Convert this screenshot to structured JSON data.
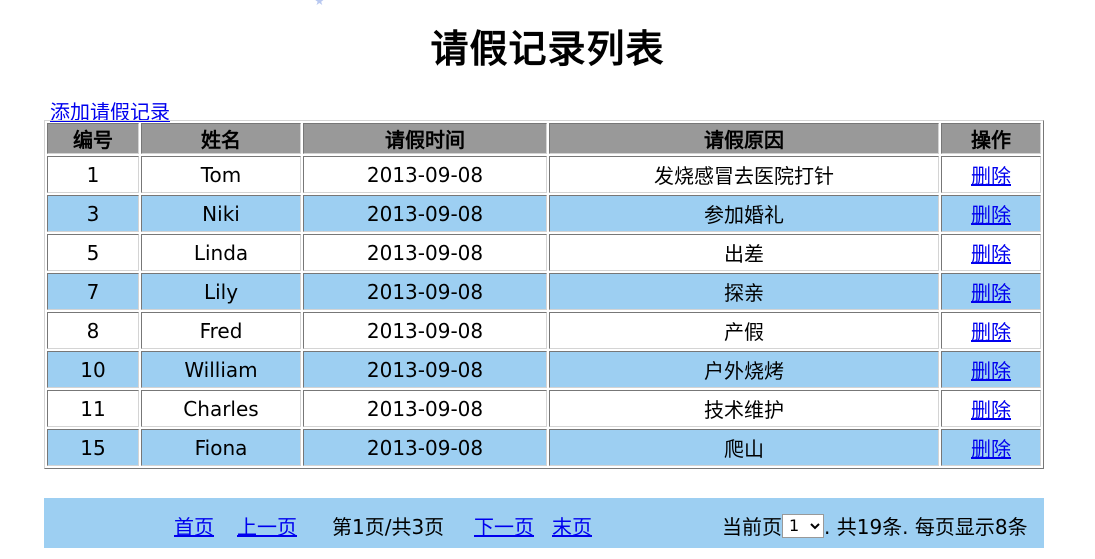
{
  "page": {
    "title": "请假记录列表",
    "add_link": "添加请假记录"
  },
  "table": {
    "headers": [
      "编号",
      "姓名",
      "请假时间",
      "请假原因",
      "操作"
    ],
    "rows": [
      {
        "id": "1",
        "name": "Tom",
        "date": "2013-09-08",
        "reason": "发烧感冒去医院打针",
        "action": "删除"
      },
      {
        "id": "3",
        "name": "Niki",
        "date": "2013-09-08",
        "reason": "参加婚礼",
        "action": "删除"
      },
      {
        "id": "5",
        "name": "Linda",
        "date": "2013-09-08",
        "reason": "出差",
        "action": "删除"
      },
      {
        "id": "7",
        "name": "Lily",
        "date": "2013-09-08",
        "reason": "探亲",
        "action": "删除"
      },
      {
        "id": "8",
        "name": "Fred",
        "date": "2013-09-08",
        "reason": "产假",
        "action": "删除"
      },
      {
        "id": "10",
        "name": "William",
        "date": "2013-09-08",
        "reason": "户外烧烤",
        "action": "删除"
      },
      {
        "id": "11",
        "name": "Charles",
        "date": "2013-09-08",
        "reason": "技术维护",
        "action": "删除"
      },
      {
        "id": "15",
        "name": "Fiona",
        "date": "2013-09-08",
        "reason": "爬山",
        "action": "删除"
      }
    ]
  },
  "pager": {
    "first": "首页",
    "prev": "上一页",
    "info": "第1页/共3页",
    "next": "下一页",
    "last": "末页",
    "current_label": "当前页",
    "current_value": "1",
    "summary": ". 共19条. 每页显示8条"
  },
  "colors": {
    "header_bg": "#999999",
    "row_alt_bg": "#9dcff2",
    "link": "#0000ee"
  }
}
